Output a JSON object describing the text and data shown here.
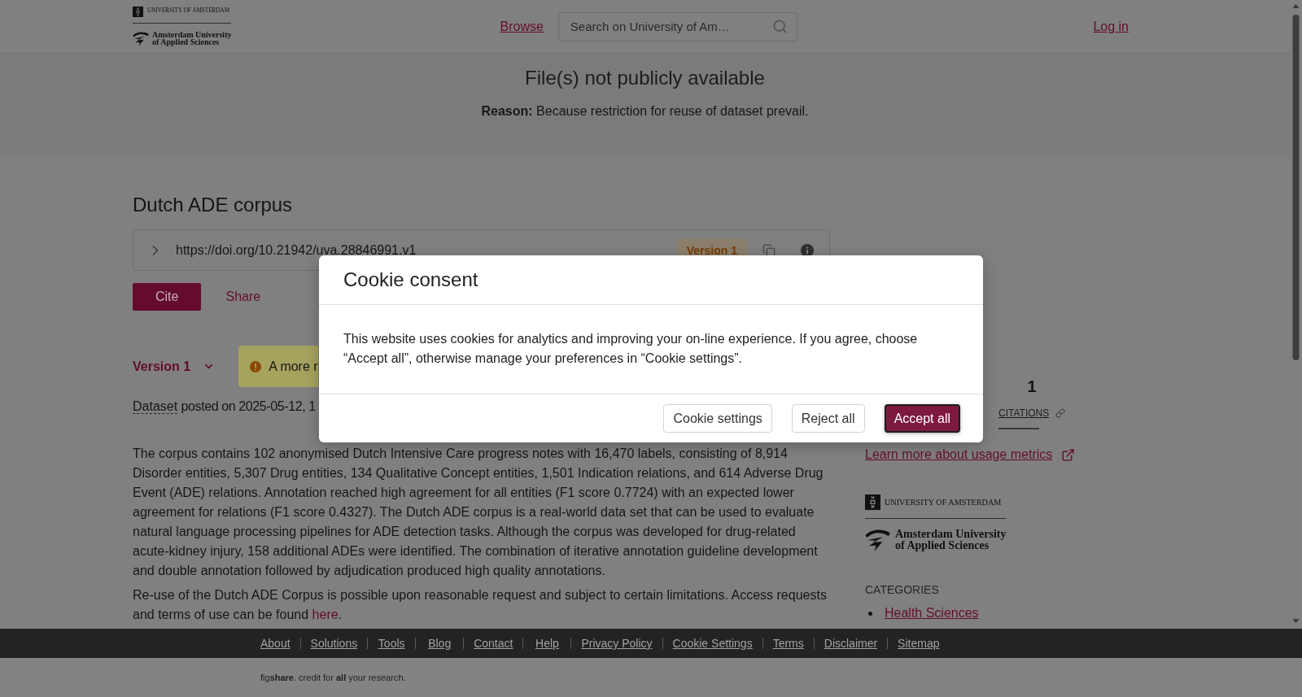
{
  "header": {
    "logo": {
      "university": "UNIVERSITY OF AMSTERDAM",
      "applied_line_1": "Amsterdam University",
      "applied_line_2": "of Applied Sciences"
    },
    "browse_link": "Browse",
    "search": {
      "placeholder": "Search on University of Am…"
    },
    "login_link": "Log in"
  },
  "availability_banner": {
    "title": "File(s) not publicly available",
    "reason": "**Reason:** Because restriction for reuse of dataset prevail."
  },
  "item": {
    "title": "Dutch ADE corpus",
    "doi": "https://doi.org/10.21942/uva.28846991.v1",
    "doi_version_badge": "Version 1",
    "actions": [
      {
        "label": "Cite",
        "kind": "primary"
      },
      {
        "label": "Share",
        "kind": "link"
      }
    ],
    "version_selector": "Version 1",
    "notice": "A more r",
    "item_type": "Dataset",
    "posted": "posted on 2025-05-12, 1",
    "description": [
      {
        "text": "The corpus contains 102 anonymised Dutch Intensive Care progress notes with 16,470 labels, consisting of 8,914 Disorder entities, 5,307 Drug entities, 134 Qualitative Concept entities, 1,501 Indication relations, and 614 Adverse Drug Event (ADE) relations. Annotation reached high agreement for all entities (F1 score 0.7724) with an expected lower agreement for relations (F1 score 0.4327). The Dutch ADE corpus is a real-world data set that can be used to evaluate natural language processing pipelines for ADE detection tasks. Although the corpus was developed for drug-related acute-kidney injury, 158 additional ADEs were identified. The combination of iterative annotation guideline development and double annotation followed by adjudication produced high quality annotations."
      },
      {
        "text": "Re-use of the Dutch ADE Corpus is possible upon reasonable request and subject to certain limitations. Access requests and terms of use can be found ",
        "link": "here",
        "after": "."
      }
    ]
  },
  "sidebar": {
    "metrics": [
      {
        "value": "1",
        "label": "CITATIONS",
        "selected": true
      }
    ],
    "usage_link": "Learn more about usage metrics",
    "logo": {
      "university": "UNIVERSITY OF AMSTERDAM",
      "applied_line_1": "Amsterdam University",
      "applied_line_2": "of Applied Sciences"
    },
    "categories": {
      "heading": "CATEGORIES",
      "items": [
        "Health Sciences"
      ]
    }
  },
  "cookie_modal": {
    "title": "Cookie consent",
    "body": "This website uses cookies for analytics and improving your on-line experience. If you agree, choose “Accept all”, otherwise manage your preferences in “Cookie settings”.",
    "buttons": [
      {
        "label": "Cookie settings",
        "kind": "secondary",
        "focused": false
      },
      {
        "label": "Reject all",
        "kind": "secondary",
        "focused": false
      },
      {
        "label": "Accept all",
        "kind": "primary",
        "focused": true
      }
    ]
  },
  "footer": {
    "links": [
      "About",
      "Solutions",
      "Tools",
      "Blog",
      "Contact",
      "Help",
      "Privacy Policy",
      "Cookie Settings",
      "Terms",
      "Disclaimer",
      "Sitemap"
    ],
    "tagline": "fig**share**. credit for **all** your research."
  }
}
